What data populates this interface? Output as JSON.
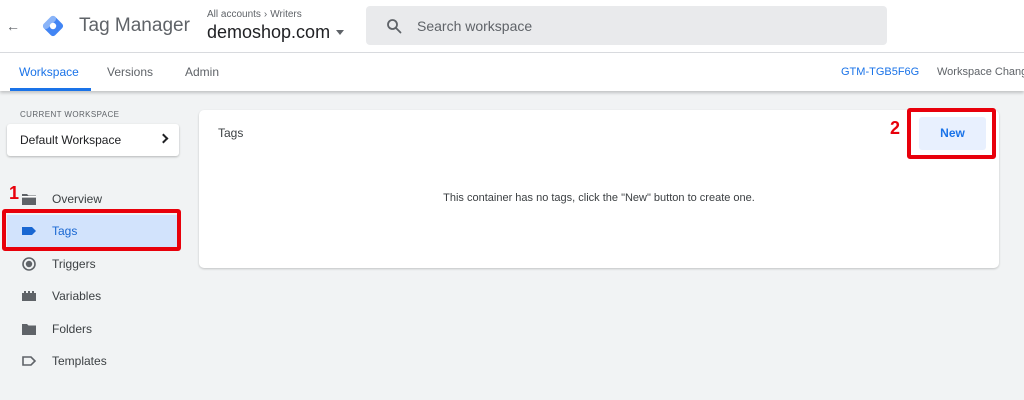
{
  "header": {
    "app_title": "Tag Manager",
    "breadcrumb": {
      "accounts_label": "All accounts",
      "account_name": "Writers"
    },
    "container_name": "demoshop.com",
    "search_placeholder": "Search workspace",
    "brand_colors": {
      "logo_blue": "#4285f4",
      "logo_dark": "#1967d2"
    }
  },
  "tabs": [
    {
      "label": "Workspace",
      "active": true
    },
    {
      "label": "Versions",
      "active": false
    },
    {
      "label": "Admin",
      "active": false
    }
  ],
  "tabbar_right": {
    "container_id": "GTM-TGB5F6G",
    "workspace_changes_label": "Workspace Chang"
  },
  "sidebar": {
    "current_workspace_caption": "CURRENT WORKSPACE",
    "workspace_name": "Default Workspace",
    "items": [
      {
        "label": "Overview",
        "icon": "folder-icon",
        "selected": false
      },
      {
        "label": "Tags",
        "icon": "tag-icon",
        "selected": true
      },
      {
        "label": "Triggers",
        "icon": "trigger-icon",
        "selected": false
      },
      {
        "label": "Variables",
        "icon": "variables-icon",
        "selected": false
      },
      {
        "label": "Folders",
        "icon": "folder-icon",
        "selected": false
      },
      {
        "label": "Templates",
        "icon": "template-icon",
        "selected": false
      }
    ]
  },
  "main": {
    "card_title": "Tags",
    "new_button_label": "New",
    "empty_message": "This container has no tags, click the \"New\" button to create one."
  },
  "annotations": {
    "step_1": "1",
    "step_2": "2",
    "highlight_color": "#e8000b"
  },
  "colors": {
    "accent": "#1a73e8",
    "selected_bg": "#d2e3fc",
    "page_bg": "#f1f3f4"
  }
}
